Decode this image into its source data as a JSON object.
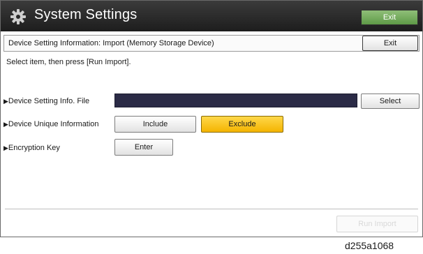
{
  "titlebar": {
    "title": "System Settings",
    "exit_label": "Exit",
    "icon": "gear-icon"
  },
  "subheader": {
    "title": "Device Setting Information: Import (Memory Storage Device)",
    "exit_label": "Exit"
  },
  "instruction": "Select item, then press [Run Import].",
  "rows": {
    "file": {
      "label": "Device Setting Info. File",
      "value": "",
      "select_label": "Select"
    },
    "unique": {
      "label": "Device Unique Information",
      "include_label": "Include",
      "exclude_label": "Exclude",
      "selected": "Exclude"
    },
    "encryption": {
      "label": "Encryption Key",
      "enter_label": "Enter"
    }
  },
  "footer": {
    "run_label": "Run Import",
    "run_enabled": false
  },
  "colors": {
    "titlebar": "#1d1d1d",
    "title_exit": "#5e9a47",
    "selected": "#f4b400",
    "file_field": "#2b2b46"
  },
  "caption": "d255a1068"
}
